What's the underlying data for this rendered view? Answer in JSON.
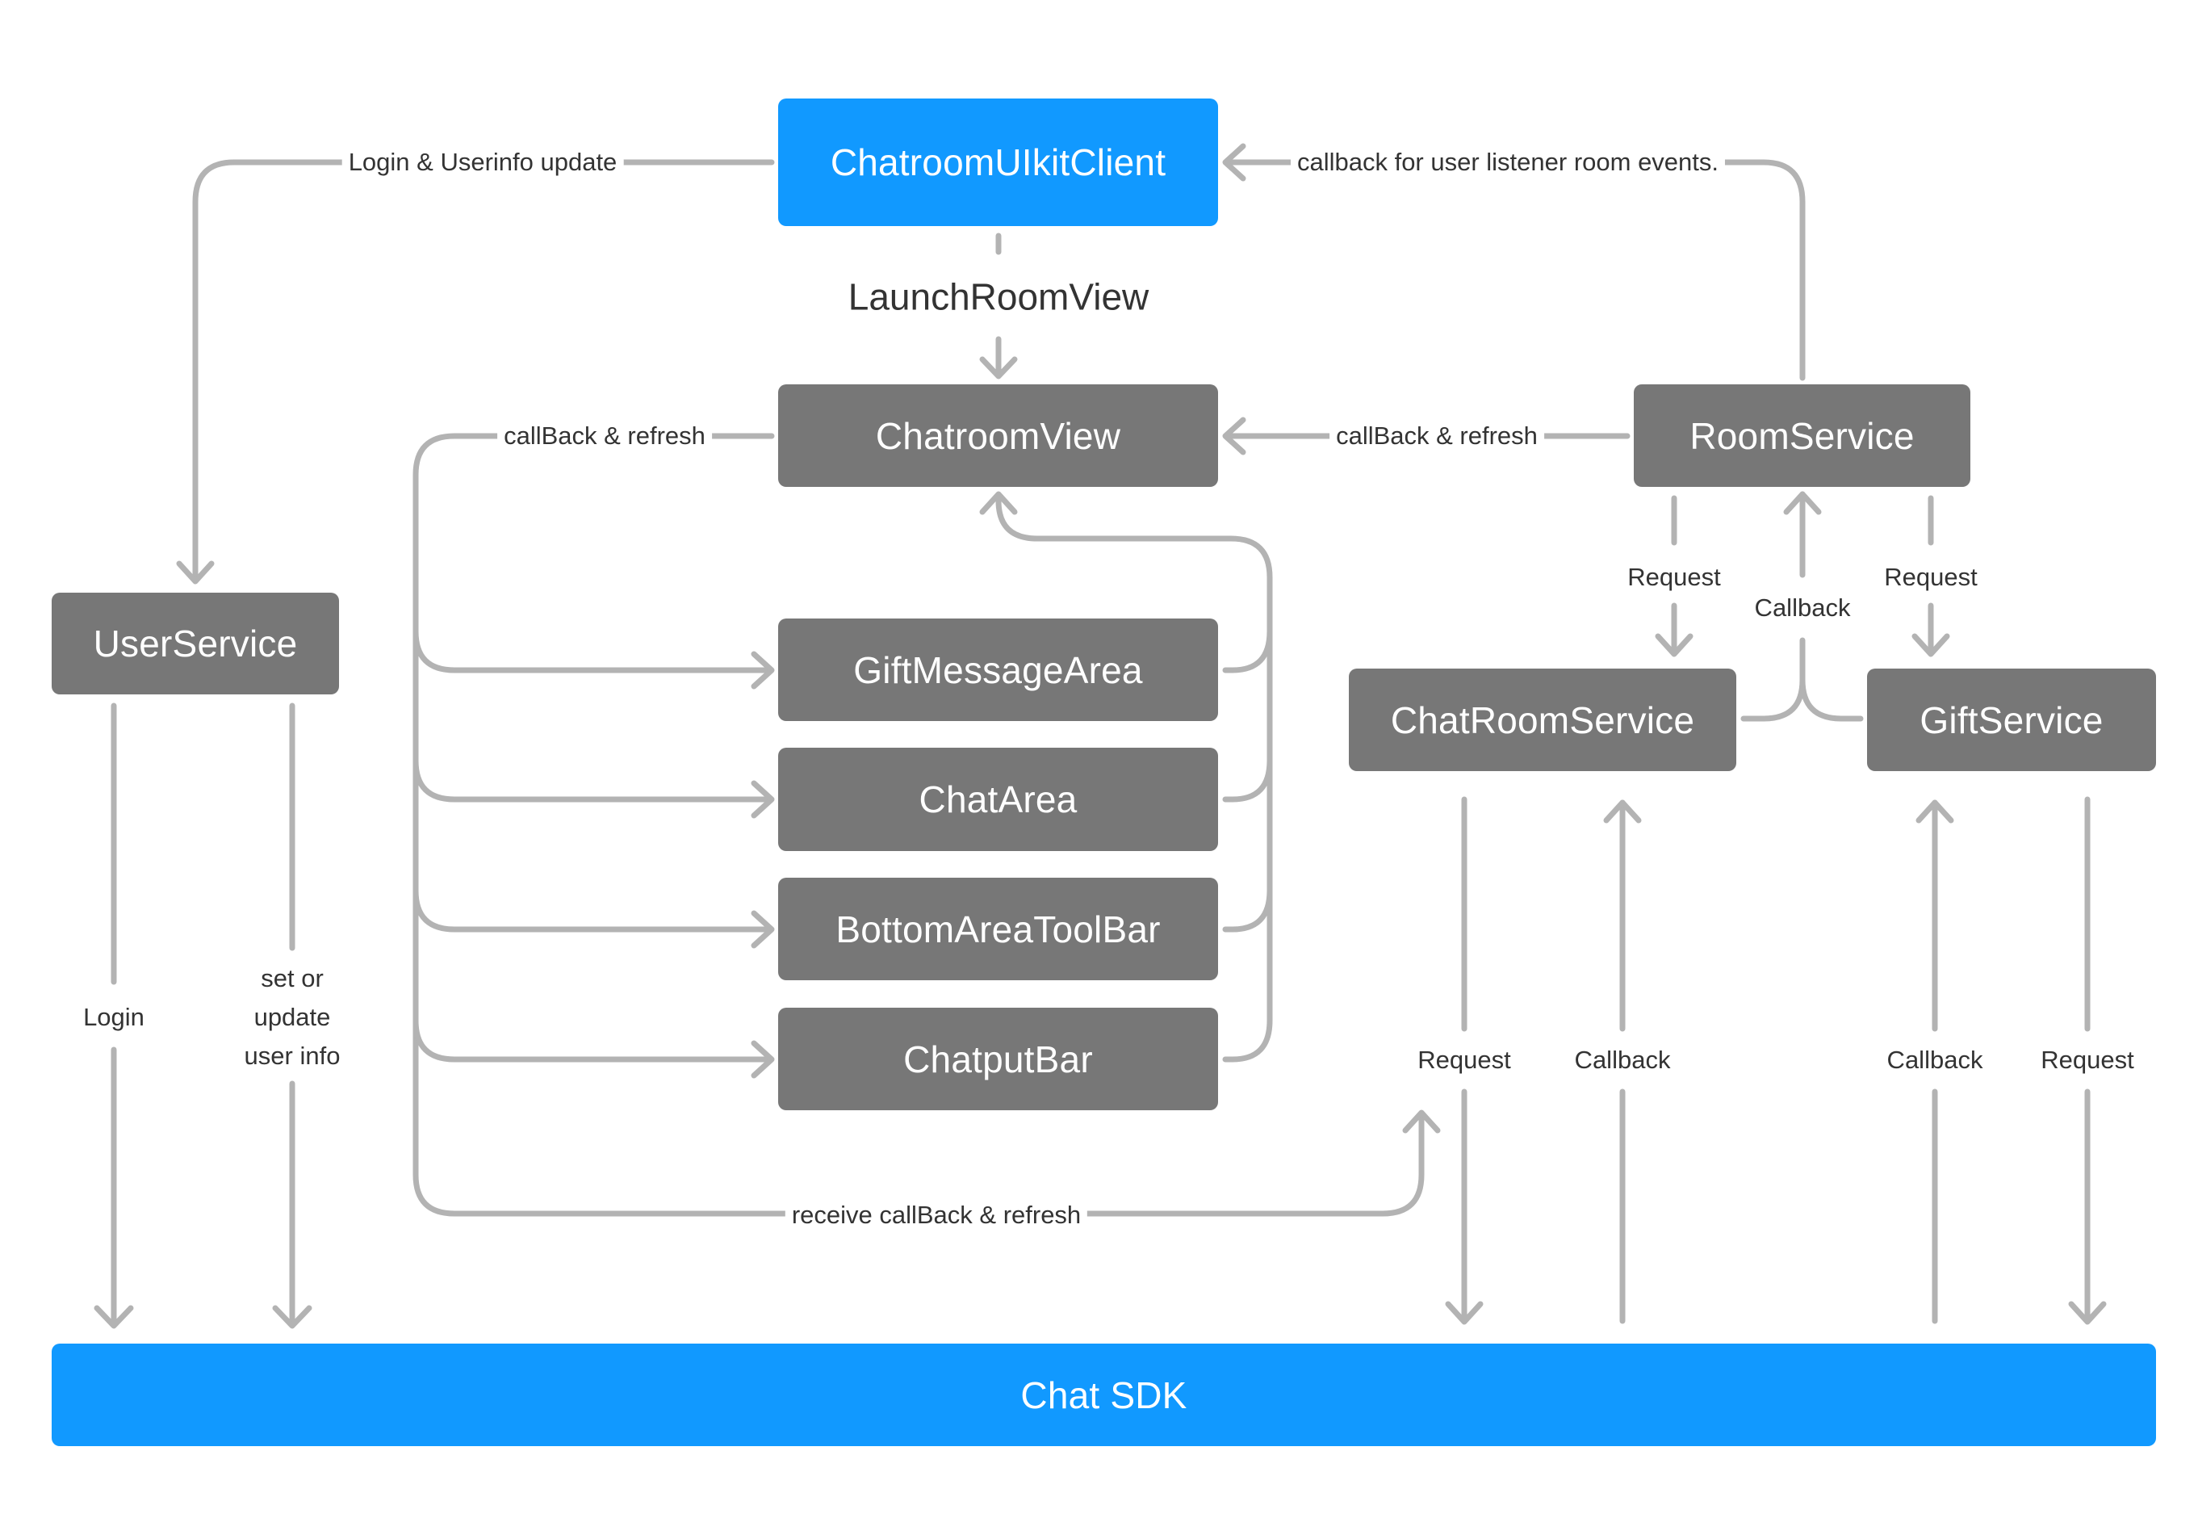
{
  "colors": {
    "primary_blue": "#1199FF",
    "service_gray": "#777777",
    "connector_gray": "#B3B3B3",
    "label_text": "#333333",
    "box_text": "#FFFFFF"
  },
  "nodes": {
    "client": "ChatroomUIkitClient",
    "chatroom_view": "ChatroomView",
    "room_service": "RoomService",
    "user_service": "UserService",
    "gift_message_area": "GiftMessageArea",
    "chat_area": "ChatArea",
    "bottom_toolbar": "BottomAreaToolBar",
    "chatput_bar": "ChatputBar",
    "chatroom_service": "ChatRoomService",
    "gift_service": "GiftService",
    "chat_sdk": "Chat SDK"
  },
  "edges": {
    "client_to_user_service": "Login & Userinfo update",
    "room_service_to_client": "callback for user listener room events.",
    "launch_room_view": "LaunchRoomView",
    "view_to_components": "callBack & refresh",
    "room_service_to_view": "callBack & refresh",
    "room_to_chatroom_service": "Request",
    "room_to_gift_service": "Request",
    "services_to_room": "Callback",
    "user_login": "Login",
    "user_set_info": "set or\nupdate\nuser info",
    "receive_callback": "receive callBack & refresh",
    "chatroom_service_request": "Request",
    "chatroom_service_callback": "Callback",
    "gift_service_callback": "Callback",
    "gift_service_request": "Request"
  }
}
